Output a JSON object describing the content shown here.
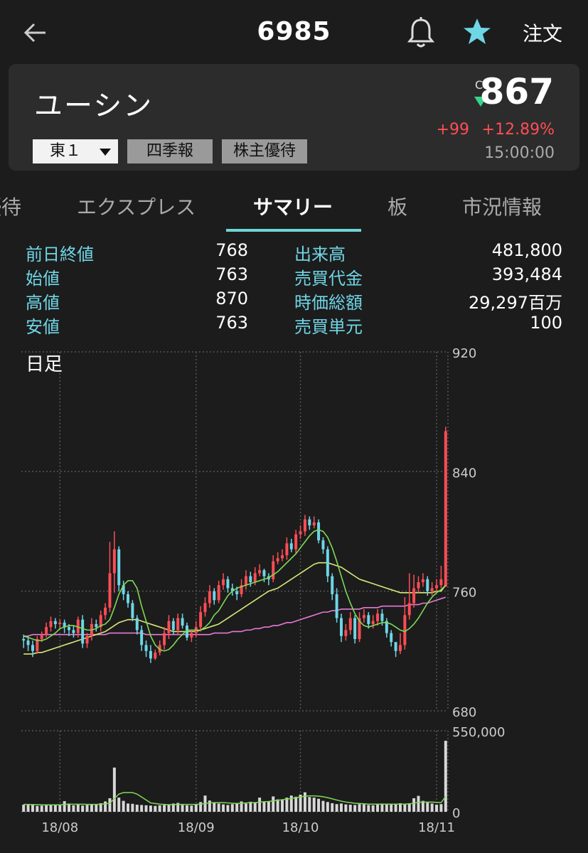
{
  "header": {
    "code": "6985",
    "order_label": "注文",
    "icons": [
      "back-arrow-icon",
      "bell-icon",
      "star-icon"
    ],
    "star_color": "#6fd6e6"
  },
  "stock": {
    "name": "ユーシン",
    "market": "東１",
    "tags": [
      "四季報",
      "株主優待"
    ],
    "price_prefix": "C",
    "price": "867",
    "change": "+99",
    "change_pct": "+12.89%",
    "time": "15:00:00",
    "up_color": "#ff4d55",
    "down_color": "#39d28a"
  },
  "tabs": [
    {
      "label": "優待",
      "active": false
    },
    {
      "label": "エクスプレス",
      "active": false
    },
    {
      "label": "サマリー",
      "active": true
    },
    {
      "label": "板",
      "active": false
    },
    {
      "label": "市況情報",
      "active": false
    }
  ],
  "summary": [
    {
      "label": "前日終値",
      "value": "768",
      "label2": "出来高",
      "value2": "481,800"
    },
    {
      "label": "始値",
      "value": "763",
      "label2": "売買代金",
      "value2": "393,484"
    },
    {
      "label": "高値",
      "value": "870",
      "label2": "時価総額",
      "value2": "29,297百万"
    },
    {
      "label": "安値",
      "value": "763",
      "label2": "売買単元",
      "value2": "100"
    }
  ],
  "chart_data": {
    "type": "candlestick",
    "title": "日足",
    "price_axis": {
      "ylim": [
        680,
        920
      ],
      "ticks": [
        920,
        840,
        760,
        680
      ]
    },
    "volume_axis": {
      "ylim": [
        0,
        550000
      ],
      "ticks": [
        550000,
        0
      ],
      "tick_labels": [
        "550,000",
        "0"
      ]
    },
    "x_tick_labels": [
      "18/08",
      "18/09",
      "18/10",
      "18/11"
    ],
    "x_tick_positions": [
      8,
      38,
      61,
      91
    ],
    "colors": {
      "up": "#ff4d55",
      "down": "#6fd6e6",
      "ma_short": "#7ed957",
      "ma_mid": "#d7e87a",
      "ma_long": "#e67ad7",
      "volume": "#d8d8d8",
      "grid": "#555555"
    },
    "closes": [
      727,
      724,
      720,
      728,
      731,
      736,
      740,
      738,
      739,
      736,
      734,
      732,
      741,
      725,
      730,
      738,
      736,
      744,
      749,
      772,
      788,
      764,
      758,
      752,
      742,
      734,
      724,
      720,
      715,
      719,
      724,
      732,
      740,
      734,
      742,
      737,
      729,
      732,
      736,
      746,
      752,
      760,
      754,
      764,
      768,
      762,
      760,
      758,
      764,
      770,
      766,
      772,
      774,
      770,
      768,
      780,
      782,
      784,
      792,
      788,
      798,
      800,
      808,
      804,
      806,
      794,
      788,
      770,
      758,
      742,
      730,
      734,
      742,
      728,
      742,
      744,
      738,
      740,
      745,
      740,
      732,
      726,
      720,
      724,
      744,
      752,
      762,
      766,
      768,
      760,
      762,
      764,
      768,
      867
    ],
    "opens": [
      728,
      727,
      724,
      720,
      728,
      731,
      736,
      740,
      738,
      739,
      736,
      734,
      732,
      741,
      725,
      730,
      738,
      736,
      744,
      749,
      772,
      788,
      764,
      758,
      752,
      742,
      734,
      724,
      720,
      715,
      719,
      724,
      732,
      740,
      734,
      742,
      737,
      729,
      732,
      736,
      746,
      752,
      760,
      754,
      764,
      768,
      762,
      760,
      758,
      764,
      770,
      766,
      772,
      774,
      770,
      768,
      780,
      782,
      784,
      792,
      788,
      798,
      800,
      808,
      804,
      806,
      794,
      788,
      770,
      758,
      742,
      730,
      734,
      742,
      728,
      742,
      744,
      738,
      740,
      745,
      740,
      732,
      726,
      720,
      724,
      744,
      752,
      762,
      766,
      768,
      760,
      762,
      764,
      763
    ],
    "highs": [
      731,
      730,
      727,
      730,
      733,
      739,
      743,
      742,
      741,
      741,
      738,
      737,
      743,
      744,
      732,
      742,
      741,
      747,
      752,
      793,
      800,
      790,
      767,
      760,
      754,
      744,
      737,
      727,
      724,
      721,
      727,
      736,
      744,
      742,
      745,
      745,
      739,
      734,
      740,
      750,
      756,
      764,
      762,
      767,
      772,
      770,
      765,
      763,
      768,
      774,
      773,
      776,
      778,
      775,
      772,
      784,
      786,
      788,
      796,
      795,
      801,
      804,
      811,
      810,
      810,
      808,
      796,
      790,
      772,
      762,
      745,
      738,
      746,
      744,
      746,
      748,
      746,
      744,
      748,
      748,
      742,
      734,
      726,
      732,
      756,
      772,
      771,
      770,
      772,
      770,
      766,
      768,
      777,
      870
    ],
    "lows": [
      722,
      720,
      716,
      718,
      726,
      729,
      733,
      735,
      735,
      732,
      730,
      729,
      729,
      722,
      722,
      727,
      733,
      733,
      741,
      746,
      759,
      760,
      754,
      749,
      740,
      731,
      720,
      716,
      712,
      714,
      717,
      721,
      728,
      731,
      731,
      735,
      727,
      726,
      729,
      733,
      743,
      749,
      751,
      752,
      761,
      759,
      757,
      754,
      756,
      761,
      763,
      764,
      770,
      766,
      764,
      766,
      778,
      780,
      781,
      786,
      785,
      795,
      797,
      801,
      802,
      792,
      785,
      766,
      754,
      739,
      726,
      727,
      731,
      725,
      726,
      739,
      735,
      735,
      737,
      737,
      729,
      723,
      716,
      718,
      721,
      741,
      749,
      759,
      763,
      757,
      757,
      759,
      762,
      763
    ],
    "ma_short": [
      730,
      729,
      728,
      727,
      727,
      728,
      730,
      732,
      735,
      736,
      737,
      737,
      736,
      735,
      734,
      734,
      735,
      737,
      738,
      741,
      749,
      758,
      764,
      767,
      767,
      762,
      750,
      740,
      730,
      724,
      721,
      720,
      721,
      724,
      728,
      731,
      734,
      734,
      734,
      734,
      736,
      739,
      744,
      747,
      752,
      757,
      760,
      762,
      763,
      764,
      765,
      766,
      767,
      768,
      769,
      771,
      773,
      776,
      779,
      782,
      785,
      789,
      793,
      797,
      800,
      801,
      800,
      796,
      789,
      780,
      770,
      760,
      752,
      745,
      740,
      737,
      736,
      737,
      738,
      739,
      739,
      738,
      736,
      734,
      733,
      735,
      738,
      742,
      747,
      752,
      756,
      759,
      761,
      764
    ],
    "ma_mid": [
      718,
      718,
      718,
      719,
      719,
      720,
      721,
      722,
      723,
      724,
      725,
      726,
      727,
      728,
      729,
      730,
      731,
      732,
      733,
      735,
      737,
      739,
      740,
      741,
      741,
      741,
      740,
      739,
      738,
      737,
      736,
      735,
      734,
      733,
      733,
      733,
      733,
      733,
      733,
      734,
      735,
      736,
      737,
      738,
      740,
      742,
      744,
      746,
      748,
      750,
      752,
      754,
      756,
      758,
      760,
      761,
      762,
      764,
      766,
      768,
      770,
      772,
      774,
      776,
      778,
      779,
      779,
      779,
      778,
      777,
      776,
      774,
      772,
      770,
      768,
      767,
      766,
      765,
      764,
      763,
      762,
      761,
      760,
      759,
      759,
      759,
      759,
      759,
      759,
      759,
      759,
      760,
      760,
      764
    ],
    "ma_long": [
      730,
      730,
      731,
      731,
      731,
      731,
      731,
      731,
      731,
      731,
      731,
      731,
      731,
      731,
      731,
      731,
      731,
      731,
      731,
      732,
      732,
      732,
      732,
      732,
      732,
      732,
      732,
      731,
      731,
      731,
      731,
      731,
      731,
      731,
      731,
      731,
      731,
      731,
      731,
      731,
      731,
      731,
      732,
      732,
      732,
      732,
      733,
      733,
      733,
      734,
      734,
      735,
      735,
      736,
      736,
      737,
      737,
      738,
      739,
      739,
      740,
      741,
      742,
      743,
      744,
      745,
      746,
      746,
      747,
      747,
      748,
      748,
      748,
      748,
      748,
      749,
      749,
      749,
      749,
      750,
      750,
      750,
      750,
      750,
      750,
      751,
      751,
      751,
      752,
      752,
      753,
      754,
      755,
      756
    ],
    "volumes": [
      48000,
      52000,
      46000,
      40000,
      42000,
      45000,
      44000,
      48000,
      50000,
      72000,
      56000,
      44000,
      50000,
      42000,
      46000,
      48000,
      52000,
      58000,
      70000,
      92000,
      300000,
      96000,
      74000,
      56000,
      54000,
      48000,
      46000,
      44000,
      42000,
      40000,
      44000,
      46000,
      48000,
      56000,
      60000,
      46000,
      44000,
      42000,
      48000,
      66000,
      110000,
      76000,
      62000,
      56000,
      50000,
      46000,
      52000,
      60000,
      70000,
      56000,
      68000,
      62000,
      96000,
      70000,
      72000,
      104000,
      84000,
      80000,
      96000,
      110000,
      102000,
      116000,
      132000,
      100000,
      96000,
      88000,
      74000,
      66000,
      58000,
      52000,
      56000,
      50000,
      48000,
      46000,
      52000,
      50000,
      46000,
      44000,
      52000,
      56000,
      48000,
      54000,
      52000,
      58000,
      52000,
      58000,
      92000,
      108000,
      74000,
      62000,
      56000,
      48000,
      52000,
      481800
    ],
    "vol_ma": [
      50000,
      50000,
      49000,
      48000,
      47000,
      47000,
      47000,
      47000,
      47000,
      50000,
      51000,
      51000,
      51000,
      51000,
      50000,
      50000,
      50000,
      51000,
      54000,
      58000,
      90000,
      120000,
      130000,
      130000,
      130000,
      120000,
      100000,
      80000,
      60000,
      56000,
      52000,
      50000,
      48000,
      48000,
      50000,
      50000,
      50000,
      50000,
      50000,
      52000,
      56000,
      60000,
      62000,
      62000,
      62000,
      60000,
      58000,
      56000,
      58000,
      60000,
      62000,
      62000,
      66000,
      68000,
      70000,
      74000,
      78000,
      82000,
      86000,
      90000,
      96000,
      100000,
      106000,
      108000,
      108000,
      106000,
      102000,
      96000,
      88000,
      80000,
      72000,
      66000,
      62000,
      58000,
      56000,
      54000,
      52000,
      52000,
      52000,
      52000,
      52000,
      52000,
      52000,
      52000,
      52000,
      54000,
      58000,
      64000,
      66000,
      66000,
      66000,
      64000,
      62000,
      104000
    ]
  }
}
